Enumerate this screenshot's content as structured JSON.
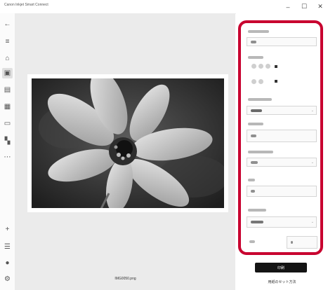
{
  "window": {
    "title": "Canon Inkjet Smart Connect",
    "minimize": "–",
    "maximize": "☐",
    "close": "✕"
  },
  "sidebar": {
    "icons": [
      "back-arrow-icon",
      "menu-icon",
      "home-icon",
      "photo-print-icon",
      "document-icon",
      "scan-icon",
      "printer-icon",
      "grid-icon",
      "more-icon",
      "add-icon",
      "list-icon",
      "user-icon",
      "settings-icon"
    ],
    "glyphs": {
      "back": "←",
      "menu": "≡",
      "home": "⌂",
      "photo": "▣",
      "document": "▤",
      "scan": "▦",
      "printer": "▭",
      "grid": "▚",
      "more": "⋯",
      "add": "+",
      "list": "☰",
      "user": "●",
      "settings": "⚙"
    }
  },
  "preview": {
    "filename": "IMG0050.png"
  },
  "panel": {
    "print_label": "印刷",
    "paper_setup_link": "用紙のセット方法",
    "highlight_color": "#c8002f"
  }
}
